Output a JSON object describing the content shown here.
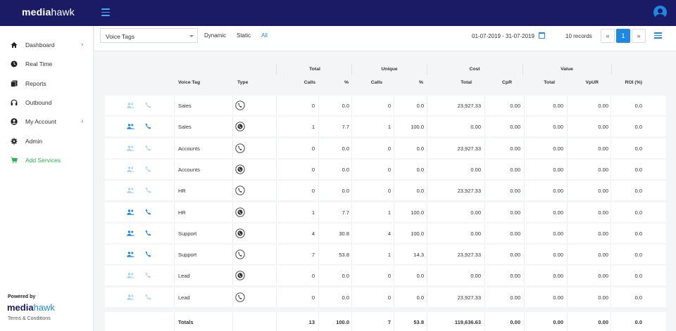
{
  "app": {
    "brand_main": "media",
    "brand_hawk": "hawk"
  },
  "sidebar": {
    "items": [
      {
        "label": "Dashboard",
        "icon": "home-icon",
        "chevron": true
      },
      {
        "label": "Real Time",
        "icon": "clock-icon",
        "chevron": false
      },
      {
        "label": "Reports",
        "icon": "reports-icon",
        "chevron": false
      },
      {
        "label": "Outbound",
        "icon": "headset-icon",
        "chevron": false
      },
      {
        "label": "My Account",
        "icon": "account-icon",
        "chevron": true
      },
      {
        "label": "Admin",
        "icon": "gear-icon",
        "chevron": false
      },
      {
        "label": "Add Services",
        "icon": "cart-icon",
        "chevron": false,
        "color": "#2cb34a"
      }
    ],
    "powered_by": "Powered by",
    "footer_brand_main": "media",
    "footer_brand_hawk": "hawk",
    "terms": "Terms & Conditions"
  },
  "filters": {
    "select_value": "Voice Tags",
    "links": [
      "Dynamic",
      "Static",
      "All"
    ],
    "active_link": "All",
    "date_range": "01-07-2019 - 31-07-2019",
    "records": "10 records",
    "pagination": {
      "prev": "«",
      "current": "1",
      "next": "»"
    }
  },
  "table": {
    "group_headers": {
      "total": "Total",
      "unique": "Unique",
      "cost": "Cost",
      "value": "Value"
    },
    "columns": {
      "voice_tag": "Voice Tag",
      "type": "Type",
      "total_calls": "Calls",
      "total_pct": "%",
      "unique_calls": "Calls",
      "unique_pct": "%",
      "cost_total": "Total",
      "cpr": "CpR",
      "value_total": "Total",
      "vpur": "VpUR",
      "roi": "ROI (%)"
    },
    "rows": [
      {
        "active": false,
        "tag": "Sales",
        "type": "static",
        "calls": "0",
        "pct": "0.0",
        "ucalls": "0",
        "upct": "0.0",
        "cost": "23,927.33",
        "cpr": "0.00",
        "value": "0.00",
        "vpur": "0.00",
        "roi": "0.0"
      },
      {
        "active": true,
        "tag": "Sales",
        "type": "dynamic",
        "calls": "1",
        "pct": "7.7",
        "ucalls": "1",
        "upct": "100.0",
        "cost": "0.00",
        "cpr": "0.00",
        "value": "0.00",
        "vpur": "0.00",
        "roi": "0.0"
      },
      {
        "active": false,
        "tag": "Accounts",
        "type": "static",
        "calls": "0",
        "pct": "0.0",
        "ucalls": "0",
        "upct": "0.0",
        "cost": "23,927.33",
        "cpr": "0.00",
        "value": "0.00",
        "vpur": "0.00",
        "roi": "0.0"
      },
      {
        "active": false,
        "tag": "Accounts",
        "type": "dynamic",
        "calls": "0",
        "pct": "0.0",
        "ucalls": "0",
        "upct": "0.0",
        "cost": "0.00",
        "cpr": "0.00",
        "value": "0.00",
        "vpur": "0.00",
        "roi": "0.0"
      },
      {
        "active": false,
        "tag": "HR",
        "type": "static",
        "calls": "0",
        "pct": "0.0",
        "ucalls": "0",
        "upct": "0.0",
        "cost": "23,927.33",
        "cpr": "0.00",
        "value": "0.00",
        "vpur": "0.00",
        "roi": "0.0"
      },
      {
        "active": true,
        "tag": "HR",
        "type": "dynamic",
        "calls": "1",
        "pct": "7.7",
        "ucalls": "1",
        "upct": "100.0",
        "cost": "0.00",
        "cpr": "0.00",
        "value": "0.00",
        "vpur": "0.00",
        "roi": "0.0"
      },
      {
        "active": true,
        "tag": "Support",
        "type": "dynamic",
        "calls": "4",
        "pct": "30.8",
        "ucalls": "4",
        "upct": "100.0",
        "cost": "0.00",
        "cpr": "0.00",
        "value": "0.00",
        "vpur": "0.00",
        "roi": "0.0"
      },
      {
        "active": true,
        "tag": "Support",
        "type": "static",
        "calls": "7",
        "pct": "53.8",
        "ucalls": "1",
        "upct": "14.3",
        "cost": "23,927.33",
        "cpr": "0.00",
        "value": "0.00",
        "vpur": "0.00",
        "roi": "0.0"
      },
      {
        "active": false,
        "tag": "Lead",
        "type": "dynamic",
        "calls": "0",
        "pct": "0.0",
        "ucalls": "0",
        "upct": "0.0",
        "cost": "0.00",
        "cpr": "0.00",
        "value": "0.00",
        "vpur": "0.00",
        "roi": "0.0"
      },
      {
        "active": false,
        "tag": "Lead",
        "type": "static",
        "calls": "0",
        "pct": "0.0",
        "ucalls": "0",
        "upct": "0.0",
        "cost": "23,927.33",
        "cpr": "0.00",
        "value": "0.00",
        "vpur": "0.00",
        "roi": "0.0"
      }
    ],
    "totals": {
      "label": "Totals",
      "calls": "13",
      "pct": "100.0",
      "ucalls": "7",
      "upct": "53.8",
      "cost": "119,636.63",
      "cpr": "0.00",
      "value": "0.00",
      "vpur": "0.00",
      "roi": "0.0"
    }
  },
  "colors": {
    "header_bg": "#1a1b64",
    "accent": "#1e88e5",
    "active_icon": "#1e88e5",
    "inactive_icon": "#a9d2f5",
    "add_services": "#2cb34a"
  }
}
